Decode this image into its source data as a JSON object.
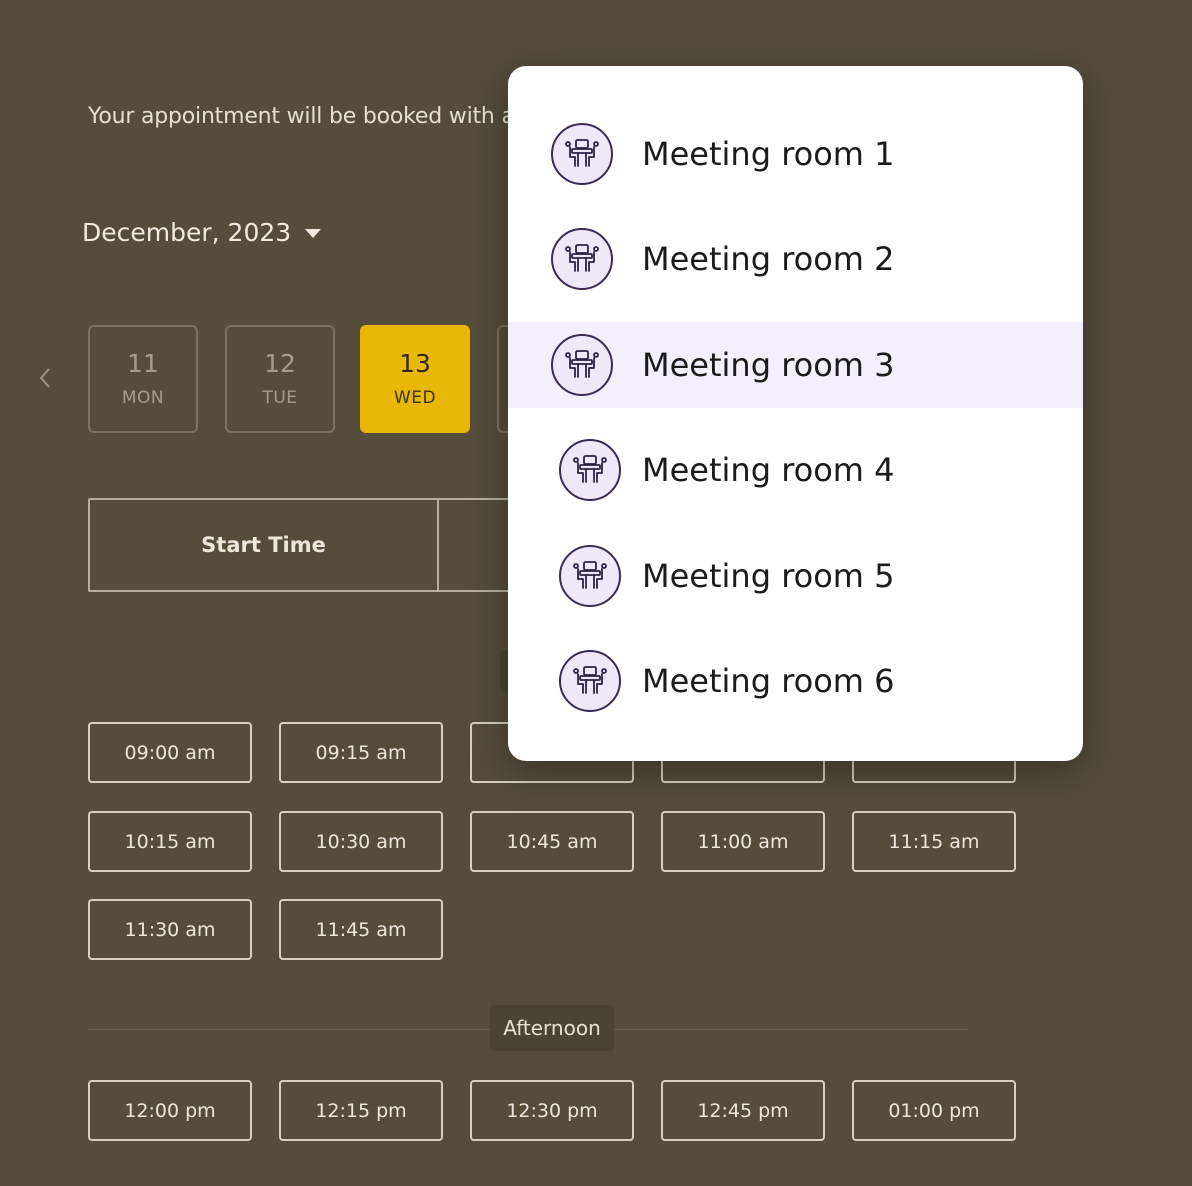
{
  "intro_text": "Your appointment will be booked with a",
  "month_label": "December, 2023",
  "days": [
    {
      "num": "11",
      "dow": "MON",
      "selected": false
    },
    {
      "num": "12",
      "dow": "TUE",
      "selected": false
    },
    {
      "num": "13",
      "dow": "WED",
      "selected": true
    }
  ],
  "table_header": {
    "start_time": "Start Time"
  },
  "morning_slots": [
    "09:00 am",
    "09:15 am",
    "10:15 am",
    "10:30 am",
    "10:45 am",
    "11:00 am",
    "11:15 am",
    "11:30 am",
    "11:45 am"
  ],
  "afternoon_label": "Afternoon",
  "afternoon_slots": [
    "12:00 pm",
    "12:15 pm",
    "12:30 pm",
    "12:45 pm",
    "01:00 pm"
  ],
  "rooms": [
    {
      "label": "Meeting room 1",
      "highlighted": false
    },
    {
      "label": "Meeting room 2",
      "highlighted": false
    },
    {
      "label": "Meeting room 3",
      "highlighted": true
    },
    {
      "label": "Meeting room 4",
      "highlighted": false
    },
    {
      "label": "Meeting room 5",
      "highlighted": false
    },
    {
      "label": "Meeting room 6",
      "highlighted": false
    }
  ],
  "icons": {
    "room": "meeting-room-icon",
    "prev": "chevron-left-icon",
    "caret": "caret-down-icon"
  },
  "colors": {
    "background": "#554d3a",
    "selected_day": "#e9b705",
    "dropdown_highlight": "#f3effc",
    "room_icon_stroke": "#3b2a55"
  }
}
